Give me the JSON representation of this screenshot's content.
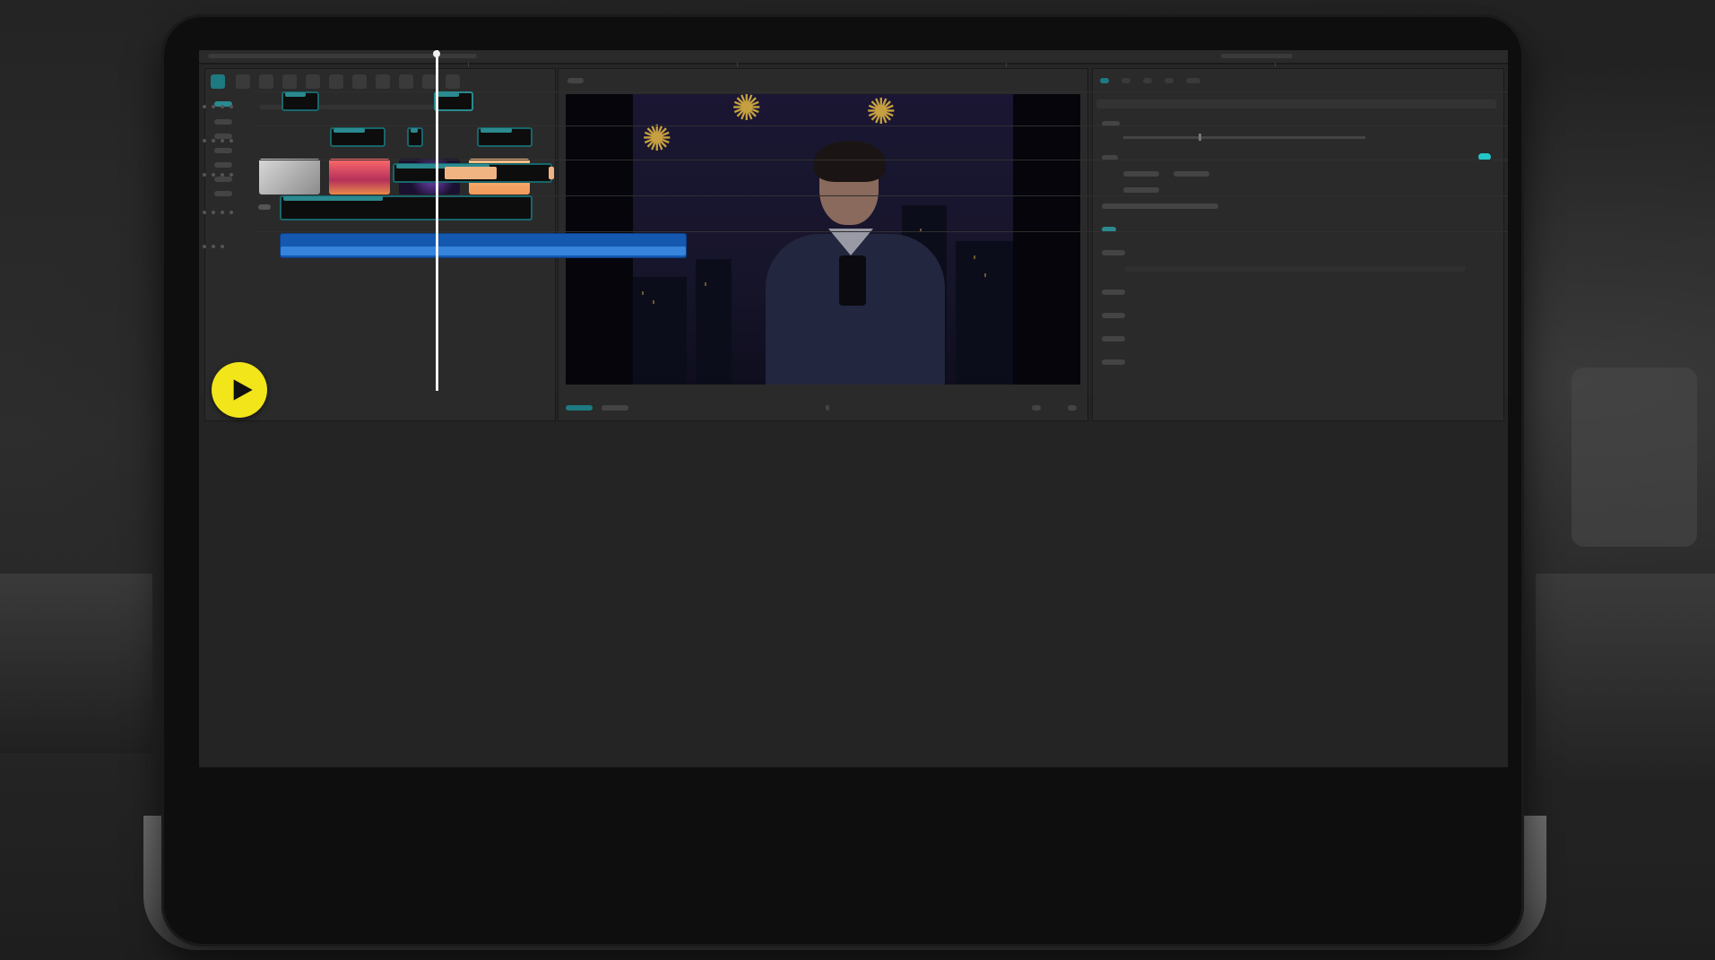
{
  "scene": {
    "app": "video-editor",
    "accent_color": "#23c6c6",
    "play_button_color": "#f2e51a"
  },
  "media_panel": {
    "thumbnails": [
      {
        "icon": "thumbnail-gray",
        "color": "#a9a9a9"
      },
      {
        "icon": "thumbnail-sunset",
        "color": "#e84a5f"
      },
      {
        "icon": "thumbnail-night",
        "color": "#2b1a4a"
      },
      {
        "icon": "thumbnail-warm",
        "color": "#f4b77a"
      }
    ]
  },
  "viewer": {
    "scene_description_icon": "anime-character-night-fireworks"
  },
  "timeline": {
    "tracks": [
      {
        "type": "video",
        "clips": 2
      },
      {
        "type": "video",
        "clips": 3
      },
      {
        "type": "video",
        "clips": 1
      },
      {
        "type": "video",
        "clips": 1
      },
      {
        "type": "audio",
        "clips": 1
      }
    ],
    "clip_color": "#18666b",
    "audio_color": "#1458b0",
    "highlight_clip_color": "#f0b483"
  },
  "overlay": {
    "play_icon": "play-icon"
  }
}
